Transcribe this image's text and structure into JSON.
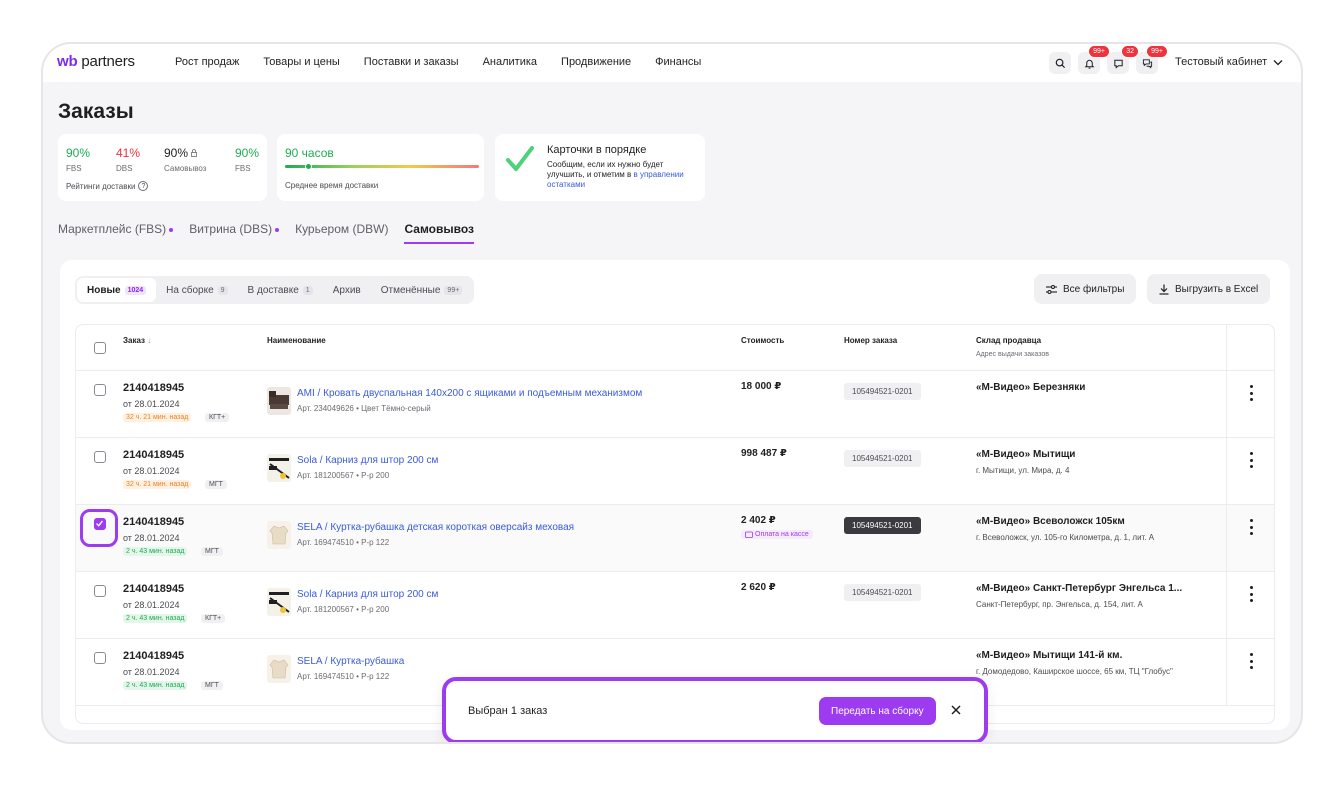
{
  "header": {
    "logo_wb": "wb",
    "logo_partners": "partners",
    "nav": [
      "Рост продаж",
      "Товары и цены",
      "Поставки и заказы",
      "Аналитика",
      "Продвижение",
      "Финансы"
    ],
    "badges": {
      "notifications": "99+",
      "chat": "32",
      "messages": "99+"
    },
    "cabinet": "Тестовый кабинет"
  },
  "page_title": "Заказы",
  "ratings": {
    "items": [
      {
        "value": "90%",
        "label": "FBS",
        "color": "#1fab55"
      },
      {
        "value": "41%",
        "label": "DBS",
        "color": "#e8343c"
      },
      {
        "value": "90%",
        "label": "Самовывоз",
        "color": "#1f1f22"
      },
      {
        "value": "90%",
        "label": "FBS",
        "color": "#1fab55"
      }
    ],
    "footer": "Рейтинги доставки"
  },
  "delivery": {
    "value": "90 часов",
    "label": "Среднее время доставки",
    "level": 0.12
  },
  "cards_status": {
    "title": "Карточки в порядке",
    "text": "Сообщим, если их нужно будет улучшить, и отметим в",
    "link": "в управлении остатками"
  },
  "type_tabs": [
    {
      "label": "Маркетплейс (FBS)",
      "dot": true,
      "active": false
    },
    {
      "label": "Витрина (DBS)",
      "dot": true,
      "active": false
    },
    {
      "label": "Курьером (DBW)",
      "dot": false,
      "active": false
    },
    {
      "label": "Самовывоз",
      "dot": false,
      "active": true
    }
  ],
  "status_tabs": [
    {
      "label": "Новые",
      "count": "1024",
      "active": true
    },
    {
      "label": "На сборке",
      "count": "9",
      "active": false
    },
    {
      "label": "В доставке",
      "count": "1",
      "active": false
    },
    {
      "label": "Архив",
      "count": "",
      "active": false
    },
    {
      "label": "Отменённые",
      "count": "99+",
      "active": false
    }
  ],
  "buttons": {
    "filters": "Все фильтры",
    "export": "Выгрузить в Excel"
  },
  "table": {
    "headers": {
      "order": "Заказ",
      "name": "Наименование",
      "cost": "Стоимость",
      "order_number": "Номер заказа",
      "warehouse": "Склад продавца",
      "warehouse_sub": "Адрес выдачи заказов"
    },
    "rows": [
      {
        "id": "2140418945",
        "date": "от 28.01.2024",
        "time": "32 ч. 21 мин. назад",
        "time_color": "orange",
        "wh_tag": "КГТ+",
        "product": "AMI / Кровать двуспальная 140х200 с ящиками и подъемным механизмом",
        "meta": "Арт. 234049626 • Цвет Тёмно-серый",
        "thumb": "bed",
        "price": "18 000 ₽",
        "pay": "",
        "number": "105494521-0201",
        "number_dark": false,
        "wh_name": "«М-Видео» Березняки",
        "wh_addr": "",
        "checked": false
      },
      {
        "id": "2140418945",
        "date": "от 28.01.2024",
        "time": "32 ч. 21 мин. назад",
        "time_color": "orange",
        "wh_tag": "МГТ",
        "product": "Sola / Карниз для штор 200 см",
        "meta": "Арт. 181200567 • Р-р 200",
        "thumb": "rod",
        "price": "998 487 ₽",
        "pay": "",
        "number": "105494521-0201",
        "number_dark": false,
        "wh_name": "«М-Видео» Мытищи",
        "wh_addr": "г. Мытищи, ул. Мира, д. 4",
        "checked": false
      },
      {
        "id": "2140418945",
        "date": "от 28.01.2024",
        "time": "2 ч. 43 мин. назад",
        "time_color": "green",
        "wh_tag": "МГТ",
        "product": "SELA / Куртка-рубашка детская короткая оверсайз меховая",
        "meta": "Арт. 169474510 • Р-р 122",
        "thumb": "jacket",
        "price": "2 402 ₽",
        "pay": "Оплата на кассе",
        "number": "105494521-0201",
        "number_dark": true,
        "wh_name": "«М-Видео» Всеволожск 105км",
        "wh_addr": "г. Всеволожск, ул. 105-го Километра, д. 1, лит. А",
        "checked": true
      },
      {
        "id": "2140418945",
        "date": "от 28.01.2024",
        "time": "2 ч. 43 мин. назад",
        "time_color": "green",
        "wh_tag": "КГТ+",
        "product": "Sola / Карниз для штор 200 см",
        "meta": "Арт. 181200567 • Р-р 200",
        "thumb": "rod",
        "price": "2 620 ₽",
        "pay": "",
        "number": "105494521-0201",
        "number_dark": false,
        "wh_name": "«М-Видео» Санкт-Петербург Энгельса 1...",
        "wh_addr": "Санкт-Петербург, пр. Энгельса, д. 154, лит. А",
        "checked": false
      },
      {
        "id": "2140418945",
        "date": "от 28.01.2024",
        "time": "2 ч. 43 мин. назад",
        "time_color": "green",
        "wh_tag": "МГТ",
        "product": "SELA / Куртка-рубашка",
        "meta": "Арт. 169474510 • Р-р 122",
        "thumb": "jacket",
        "price": "",
        "pay": "",
        "number": "",
        "number_dark": false,
        "wh_name": "«М-Видео» Мытищи 141-й км.",
        "wh_addr": "г. Домодедово, Каширское шоссе, 65 км, ТЦ \"Глобус\"",
        "checked": false
      }
    ]
  },
  "snackbar": {
    "text": "Выбран 1 заказ",
    "button": "Передать на сборку"
  },
  "colors": {
    "accent": "#9c3bf0",
    "link": "#3b5bd9",
    "green": "#1fab55",
    "red": "#e8343c"
  }
}
